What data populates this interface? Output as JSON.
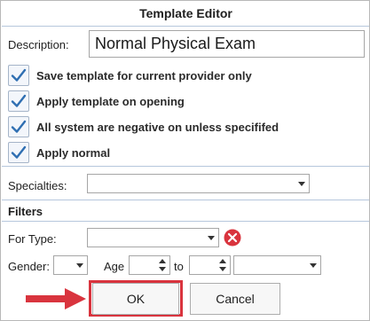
{
  "dialog": {
    "title": "Template Editor"
  },
  "description": {
    "label": "Description:",
    "value": "Normal Physical Exam"
  },
  "options": [
    {
      "label": "Save template for current provider only",
      "checked": true
    },
    {
      "label": "Apply template on opening",
      "checked": true
    },
    {
      "label": "All system are negative on unless specififed",
      "checked": true
    },
    {
      "label": "Apply normal",
      "checked": true
    }
  ],
  "specialties": {
    "label": "Specialties:",
    "value": ""
  },
  "filters": {
    "title": "Filters",
    "for_type_label": "For Type:",
    "for_type_value": "",
    "gender_label": "Gender:",
    "gender_value": "",
    "age_label": "Age",
    "age_from": "",
    "to_label": "to",
    "age_to": "",
    "age_unit": ""
  },
  "buttons": {
    "ok": "OK",
    "cancel": "Cancel"
  },
  "colors": {
    "check": "#2f6fb2",
    "clear_icon": "#d9343e",
    "highlight": "#d9343e",
    "divider": "#b6c7dc"
  }
}
